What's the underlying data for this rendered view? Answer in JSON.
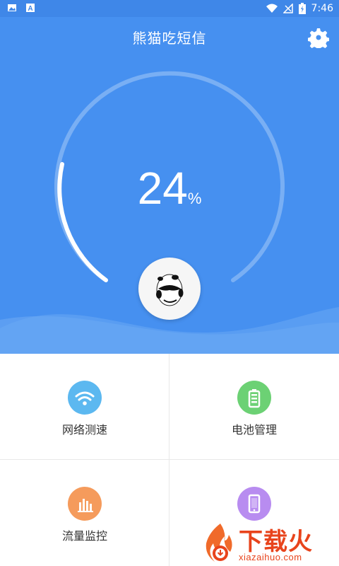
{
  "status_bar": {
    "time": "7:46",
    "left_icons": [
      "image-icon",
      "a-icon"
    ],
    "right_icons": [
      "wifi-icon",
      "signal-icon",
      "battery-icon"
    ]
  },
  "header": {
    "title": "熊猫吃短信",
    "settings_icon": "gear-icon"
  },
  "gauge": {
    "value": "24",
    "unit": "%",
    "progress": 0.24
  },
  "grid": {
    "items": [
      {
        "label": "网络测速",
        "icon": "wifi-icon",
        "color": "#5cb8f0"
      },
      {
        "label": "电池管理",
        "icon": "battery-icon",
        "color": "#6cd174"
      },
      {
        "label": "流量监控",
        "icon": "bar-chart-icon",
        "color": "#f59b5c"
      },
      {
        "label": "",
        "icon": "phone-icon",
        "color": "#b88cf0"
      }
    ]
  },
  "watermark": {
    "brand": "下载火",
    "domain": "xiazaihuo.com"
  },
  "colors": {
    "primary": "#4690f0",
    "status_bar": "#3f87e8",
    "wave": "#6aa8f4"
  }
}
